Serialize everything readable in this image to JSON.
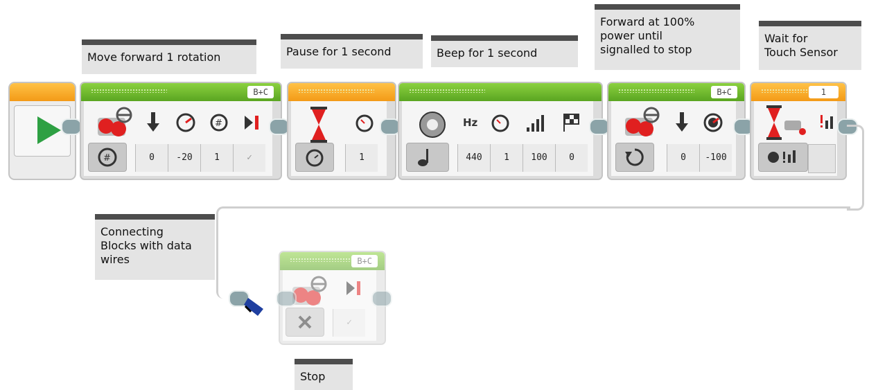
{
  "comments": {
    "move_forward": "Move forward 1 rotation",
    "pause": "Pause for 1 second",
    "beep": "Beep for 1 second",
    "forward_until": "Forward at 100%\npower until\nsignalled to stop",
    "wait_touch": "Wait for\nTouch Sensor",
    "connecting": "Connecting\nBlocks with data\nwires",
    "stop": "Stop"
  },
  "blocks": {
    "move_steering_1": {
      "ports": "B+C",
      "values": [
        "0",
        "-20",
        "1",
        "✓"
      ]
    },
    "wait_time": {
      "values": [
        "1"
      ]
    },
    "sound": {
      "values": [
        "440",
        "1",
        "100",
        "0"
      ],
      "hz_label": "Hz"
    },
    "move_steering_2": {
      "ports": "B+C",
      "values": [
        "0",
        "-100"
      ]
    },
    "wait_touch": {
      "port": "1"
    },
    "move_stop": {
      "ports": "B+C",
      "values": [
        "✓"
      ]
    }
  },
  "colors": {
    "action_bar": "#6cbd2c",
    "flow_bar": "#f7a52a",
    "start_arrow": "#2ea043",
    "comment_bg": "#e4e4e4",
    "comment_band": "#4d4d4d"
  },
  "icons": [
    "play-icon",
    "large-motor-icon",
    "steering-icon",
    "down-arrow-icon",
    "speedometer-icon",
    "rotations-icon",
    "brake-icon",
    "hourglass-icon",
    "timer-icon",
    "speaker-icon",
    "note-icon",
    "volume-icon",
    "finish-flag-icon",
    "touch-sensor-icon",
    "close-icon",
    "wire-plug-icon"
  ]
}
